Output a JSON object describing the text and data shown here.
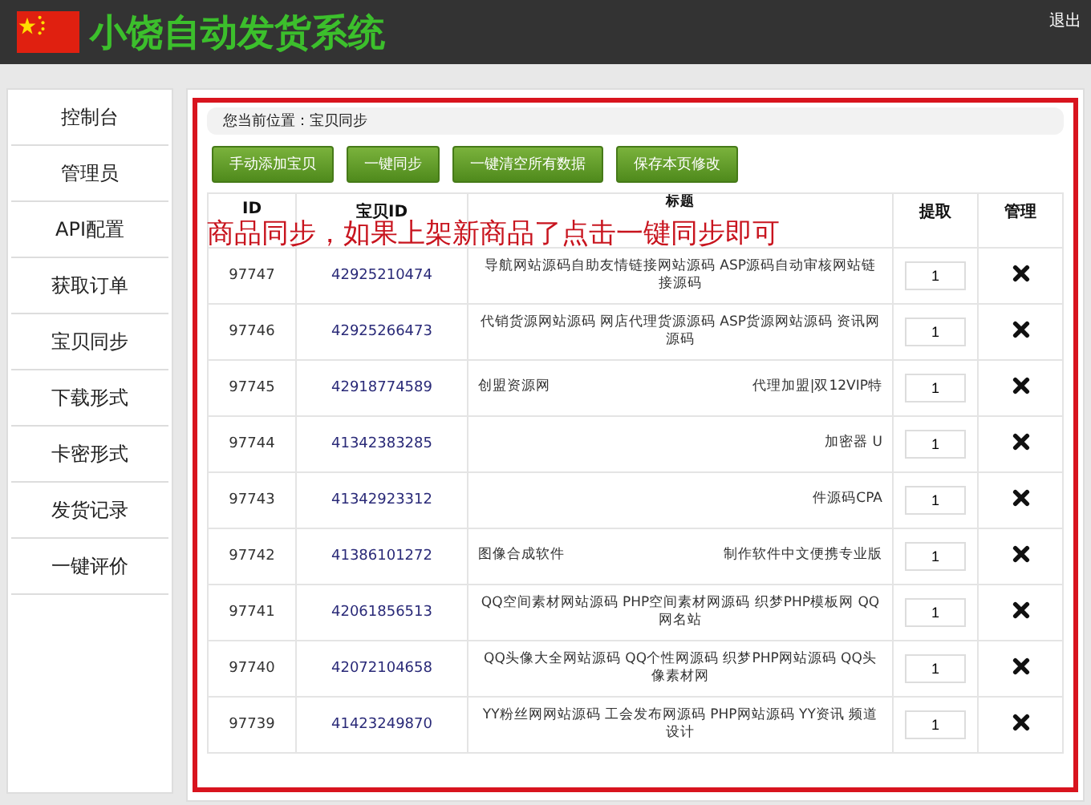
{
  "header": {
    "title": "小饶自动发货系统",
    "logout": "退出"
  },
  "sidebar": {
    "items": [
      {
        "label": "控制台"
      },
      {
        "label": "管理员"
      },
      {
        "label": "API配置"
      },
      {
        "label": "获取订单"
      },
      {
        "label": "宝贝同步"
      },
      {
        "label": "下载形式"
      },
      {
        "label": "卡密形式"
      },
      {
        "label": "发货记录"
      },
      {
        "label": "一键评价"
      }
    ]
  },
  "breadcrumb": "您当前位置：宝贝同步",
  "buttons": [
    "手动添加宝贝",
    "一键同步",
    "一键清空所有数据",
    "保存本页修改"
  ],
  "annotation": "商品同步，如果上架新商品了点击一键同步即可",
  "table": {
    "columns": [
      "ID",
      "宝贝ID",
      "标题",
      "提取",
      "管理"
    ],
    "rows": [
      {
        "id": "97747",
        "item_id": "42925210474",
        "title": "导航网站源码自助友情链接网站源码 ASP源码自动审核网站链接源码",
        "extract": "1"
      },
      {
        "id": "97746",
        "item_id": "42925266473",
        "title": "代销货源网站源码 网店代理货源源码 ASP货源网站源码 资讯网源码",
        "extract": "1"
      },
      {
        "id": "97745",
        "item_id": "42918774589",
        "title_start": "创盟资源网",
        "title_end": "代理加盟|双12VIP特",
        "extract": "1"
      },
      {
        "id": "97744",
        "item_id": "41342383285",
        "title_end": "加密器 U",
        "extract": "1"
      },
      {
        "id": "97743",
        "item_id": "41342923312",
        "title_end": "件源码CPA",
        "extract": "1"
      },
      {
        "id": "97742",
        "item_id": "41386101272",
        "title_start": "图像合成软件",
        "title_end": "制作软件中文便携专业版",
        "extract": "1"
      },
      {
        "id": "97741",
        "item_id": "42061856513",
        "title": "QQ空间素材网站源码 PHP空间素材网源码 织梦PHP模板网 QQ网名站",
        "extract": "1"
      },
      {
        "id": "97740",
        "item_id": "42072104658",
        "title": "QQ头像大全网站源码 QQ个性网源码 织梦PHP网站源码 QQ头像素材网",
        "extract": "1"
      },
      {
        "id": "97739",
        "item_id": "41423249870",
        "title": "YY粉丝网网站源码 工会发布网源码 PHP网站源码 YY资讯 频道设计",
        "extract": "1"
      }
    ]
  }
}
